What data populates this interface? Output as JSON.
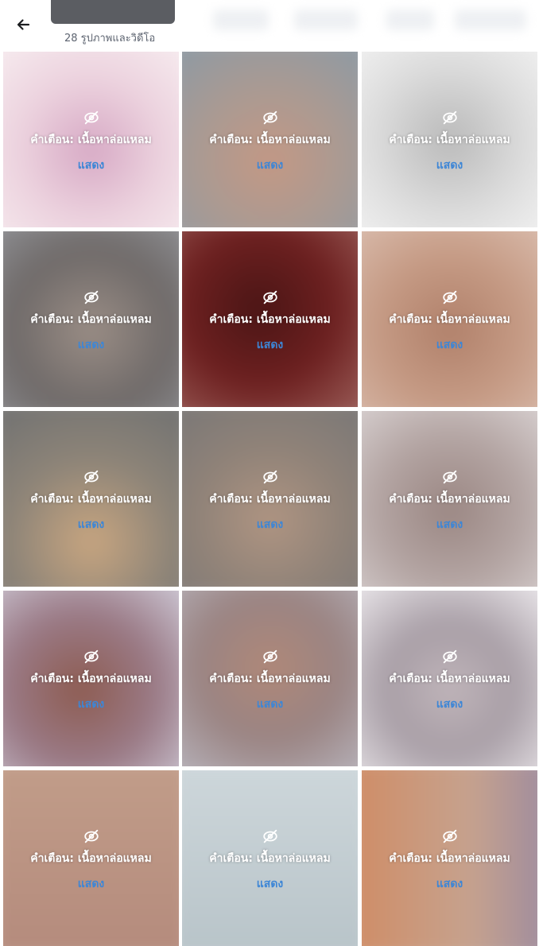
{
  "header": {
    "back_icon": "arrow-left-icon",
    "subtitle": "28 รูปภาพและวิดีโอ"
  },
  "tile": {
    "icon": "eye-slash-icon",
    "warning_text": "คำเตือน: เนื้อหาล่อแหลม",
    "show_label": "แสดง"
  },
  "colors": {
    "show_link": "#3d86d6",
    "warning_text": "#ffffff",
    "background": "#ffffff"
  },
  "tiles": [
    {
      "bg": "radial-gradient(circle at 50% 55%, #d6a8c4 0%, #ecd2de 45%, #f6eaee 85%)"
    },
    {
      "bg": "radial-gradient(circle at 50% 60%, #c49884 0%, #a99a93 45%, #8f9aa3 85%)"
    },
    {
      "bg": "radial-gradient(circle at 50% 50%, #b9b9b9 0%, #dcdcdc 50%, #efefef 85%)"
    },
    {
      "bg": "radial-gradient(circle at 50% 55%, #9b8e86 0%, #6f6a69 50%, #8f9094 90%)"
    },
    {
      "bg": "radial-gradient(circle at 45% 45%, #4a1515 0%, #6d2020 45%, #9c5f5a 90%)"
    },
    {
      "bg": "radial-gradient(circle at 50% 55%, #b0806a 0%, #c59a84 45%, #d7b8a8 85%)"
    },
    {
      "bg": "radial-gradient(circle at 50% 70%, #c9a680 0%, #8d8478 45%, #737372 85%)"
    },
    {
      "bg": "radial-gradient(circle at 50% 60%, #b09582 0%, #8f8278 45%, #7b7877 85%)"
    },
    {
      "bg": "radial-gradient(circle at 50% 55%, #9a8682 0%, #b3a4a2 45%, #d4cccc 85%)"
    },
    {
      "bg": "radial-gradient(circle at 45% 55%, #8d5b50 0%, #9a7a86 45%, #c9c2cf 85%)"
    },
    {
      "bg": "radial-gradient(circle at 50% 45%, #b08878 0%, #9a8483 45%, #b4aeb5 85%)"
    },
    {
      "bg": "radial-gradient(circle at 50% 55%, #c0b5ba 0%, #a89ea6 40%, #e6e2e6 85%)"
    },
    {
      "bg": "linear-gradient(180deg, #c29e8a 0%, #b48a7c 100%)"
    },
    {
      "bg": "linear-gradient(180deg, #cfd8dc 0%, #b7c3c8 100%)"
    },
    {
      "bg": "linear-gradient(90deg, #d08b63 0%, #c6a28e 60%, #9a89a0 100%)"
    }
  ]
}
